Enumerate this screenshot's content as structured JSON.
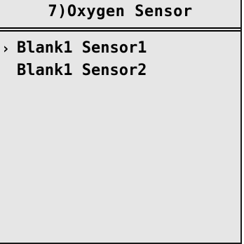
{
  "screen": {
    "title": "7)Oxygen Sensor"
  },
  "menu": {
    "cursor_glyph": "›",
    "selected_index": 0,
    "items": [
      {
        "label": "Blank1 Sensor1"
      },
      {
        "label": "Blank1 Sensor2"
      }
    ]
  }
}
